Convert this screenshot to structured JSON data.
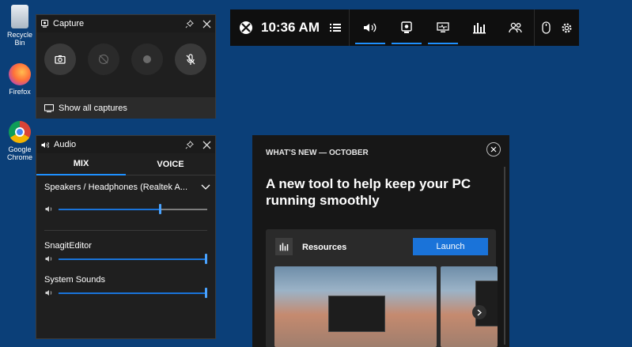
{
  "desktop": {
    "recycle_bin": "Recycle Bin",
    "firefox": "Firefox",
    "chrome": "Google Chrome"
  },
  "gamebar": {
    "time": "10:36 AM",
    "icons": [
      "xbox-logo",
      "menu",
      "volume",
      "capture",
      "performance",
      "resources",
      "social",
      "mouse",
      "settings"
    ]
  },
  "capture": {
    "title": "Capture",
    "show_all": "Show all captures"
  },
  "audio": {
    "title": "Audio",
    "tab_mix": "MIX",
    "tab_voice": "VOICE",
    "device": "Speakers / Headphones (Realtek A...",
    "device_volume": 0.68,
    "apps": [
      {
        "name": "SnagitEditor",
        "volume": 1.0
      },
      {
        "name": "System Sounds",
        "volume": 1.0
      }
    ]
  },
  "whatsnew": {
    "kicker": "WHAT'S NEW — OCTOBER",
    "headline": "A new tool to help keep your PC running smoothly",
    "card_title": "Resources",
    "launch": "Launch"
  },
  "colors": {
    "accent": "#1a73d9",
    "desktop": "#0b3f78",
    "panel": "#1f1f1f"
  }
}
